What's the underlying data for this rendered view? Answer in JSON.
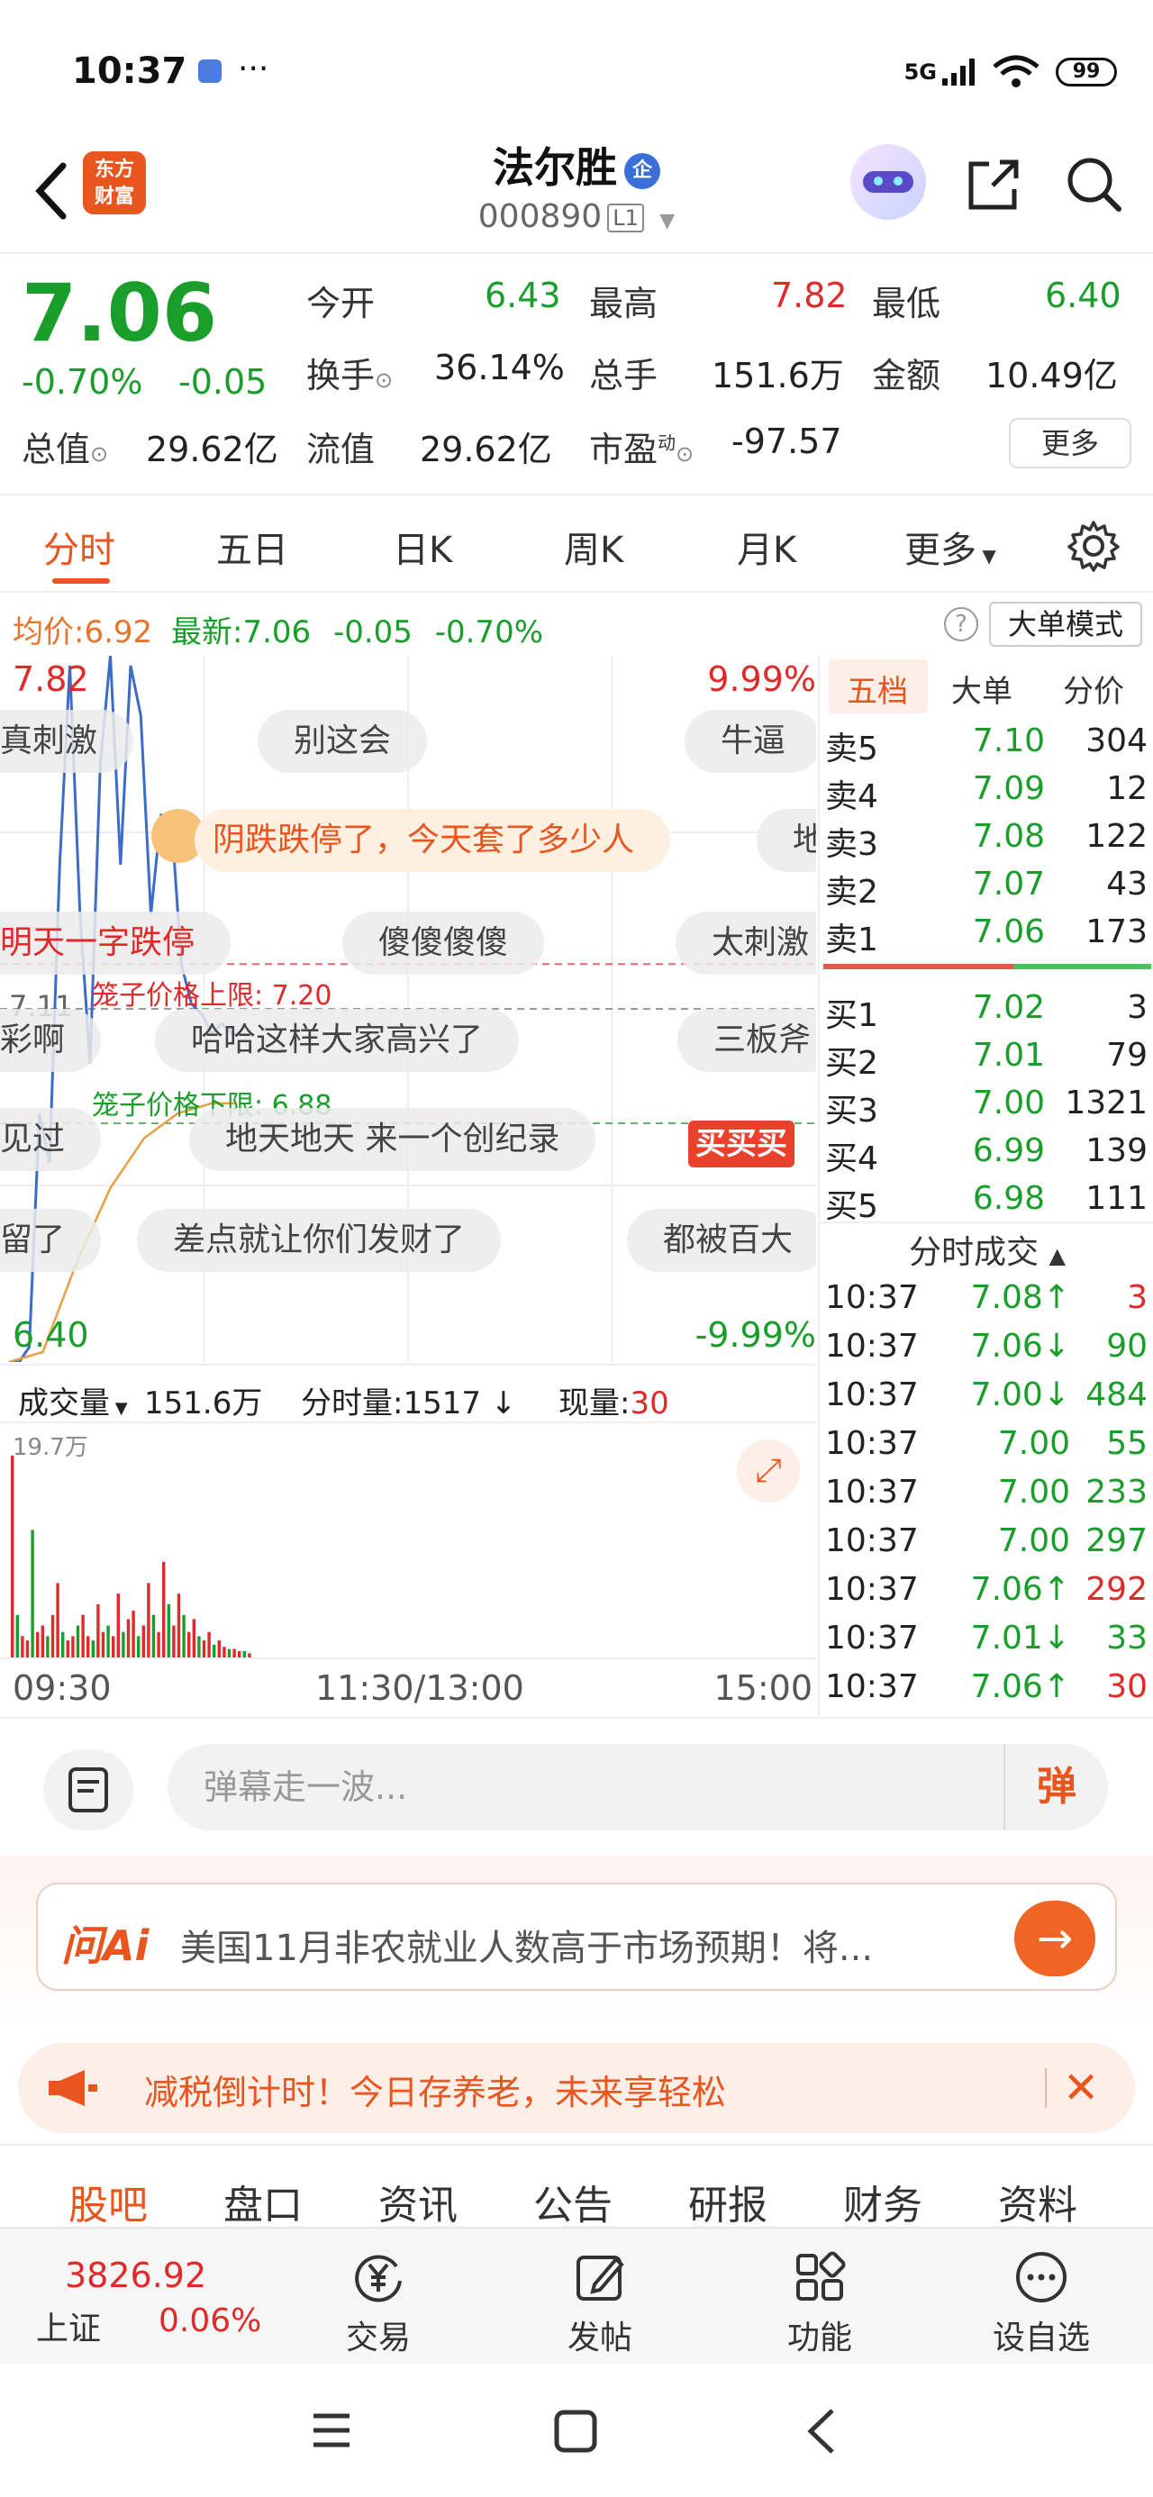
{
  "status": {
    "time": "10:37",
    "network": "5G",
    "battery": "99"
  },
  "header": {
    "logo_line1": "东方",
    "logo_line2": "财富",
    "stock_name": "法尔胜",
    "badge": "企",
    "stock_code": "000890",
    "level": "L1"
  },
  "quote": {
    "price": "7.06",
    "change_pct": "-0.70%",
    "change_abs": "-0.05",
    "open_label": "今开",
    "open": "6.43",
    "high_label": "最高",
    "high": "7.82",
    "low_label": "最低",
    "low": "6.40",
    "turnover_label": "换手",
    "turnover": "36.14%",
    "volume_label": "总手",
    "volume": "151.6万",
    "amount_label": "金额",
    "amount": "10.49亿",
    "mktcap_label": "总值",
    "mktcap": "29.62亿",
    "float_label": "流值",
    "float_cap": "29.62亿",
    "pe_label": "市盈",
    "pe_sup": "动",
    "pe": "-97.57",
    "more": "更多"
  },
  "tabs": [
    "分时",
    "五日",
    "日K",
    "周K",
    "月K",
    "更多"
  ],
  "avg_bar": {
    "avg_label": "均价:",
    "avg": "6.92",
    "last_label": "最新:",
    "last": "7.06",
    "chg": "-0.05",
    "pct": "-0.70%",
    "big_order": "大单模式"
  },
  "chart": {
    "high_price": "7.82",
    "high_pct": "9.99%",
    "low_price": "6.40",
    "low_pct": "-9.99%",
    "ref_price": "7.11",
    "cage_upper": "笼子价格上限: 7.20",
    "cage_lower": "笼子价格下限: 6.88",
    "danmu": [
      "真刺激",
      "别这会",
      "牛逼",
      "阴跌跌停了，今天套了多少人",
      "地",
      "明天一字跌停",
      "傻傻傻傻",
      "太刺激",
      "彩啊",
      "哈哈这样大家高兴了",
      "三板斧",
      "见过",
      "地天地天 来一个创纪录",
      "留了",
      "差点就让你们发财了",
      "都被百大"
    ],
    "buy_stamp": "买买买"
  },
  "chart_data": {
    "type": "line",
    "title": "",
    "x_ticks": [
      "09:30",
      "11:30/13:00",
      "15:00"
    ],
    "ylim": [
      6.4,
      7.82
    ],
    "series": [
      {
        "name": "最新",
        "x": [
          "09:30",
          "09:33",
          "09:36",
          "09:39",
          "09:42",
          "09:45",
          "09:48",
          "09:51",
          "09:54",
          "09:57",
          "10:00",
          "10:03",
          "10:06",
          "10:09",
          "10:12",
          "10:15",
          "10:18",
          "10:21",
          "10:24",
          "10:27",
          "10:30",
          "10:33",
          "10:36",
          "10:37"
        ],
        "values": [
          6.4,
          6.4,
          6.43,
          6.9,
          6.8,
          7.4,
          7.8,
          7.3,
          7.0,
          7.6,
          7.82,
          7.4,
          7.8,
          7.7,
          7.3,
          7.5,
          7.5,
          7.2,
          7.12,
          7.1,
          7.06,
          7.08,
          7.06,
          7.06
        ]
      },
      {
        "name": "均价",
        "x": [
          "09:30",
          "09:40",
          "09:50",
          "10:00",
          "10:10",
          "10:20",
          "10:30",
          "10:37"
        ],
        "values": [
          6.4,
          6.42,
          6.6,
          6.75,
          6.85,
          6.9,
          6.92,
          6.92
        ]
      }
    ]
  },
  "volume": {
    "label": "成交量",
    "total": "151.6万",
    "minute_label": "分时量:",
    "minute": "1517",
    "now_label": "现量:",
    "now": "30",
    "max": "19.7万",
    "x_start": "09:30",
    "x_mid": "11:30/13:00",
    "x_end": "15:00"
  },
  "orderbook": {
    "tabs": [
      "五档",
      "大单",
      "分价"
    ],
    "asks": [
      {
        "label": "卖5",
        "price": "7.10",
        "qty": "304"
      },
      {
        "label": "卖4",
        "price": "7.09",
        "qty": "12"
      },
      {
        "label": "卖3",
        "price": "7.08",
        "qty": "122"
      },
      {
        "label": "卖2",
        "price": "7.07",
        "qty": "43"
      },
      {
        "label": "卖1",
        "price": "7.06",
        "qty": "173"
      }
    ],
    "bids": [
      {
        "label": "买1",
        "price": "7.02",
        "qty": "3"
      },
      {
        "label": "买2",
        "price": "7.01",
        "qty": "79"
      },
      {
        "label": "买3",
        "price": "7.00",
        "qty": "1321"
      },
      {
        "label": "买4",
        "price": "6.99",
        "qty": "139"
      },
      {
        "label": "买5",
        "price": "6.98",
        "qty": "111"
      }
    ],
    "ticks_title": "分时成交",
    "ticks": [
      {
        "time": "10:37",
        "price": "7.08↑",
        "vol": "3"
      },
      {
        "time": "10:37",
        "price": "7.06↓",
        "vol": "90"
      },
      {
        "time": "10:37",
        "price": "7.00↓",
        "vol": "484"
      },
      {
        "time": "10:37",
        "price": "7.00",
        "vol": "55"
      },
      {
        "time": "10:37",
        "price": "7.00",
        "vol": "233"
      },
      {
        "time": "10:37",
        "price": "7.00",
        "vol": "297"
      },
      {
        "time": "10:37",
        "price": "7.06↑",
        "vol": "292"
      },
      {
        "time": "10:37",
        "price": "7.01↓",
        "vol": "33"
      },
      {
        "time": "10:37",
        "price": "7.06↑",
        "vol": "30"
      }
    ]
  },
  "comment": {
    "placeholder": "弹幕走一波...",
    "send": "弹"
  },
  "ai": {
    "logo": "问Ai",
    "text": "美国11月非农就业人数高于市场预期！将..."
  },
  "promo": {
    "text": "减税倒计时！今日存养老，未来享轻松"
  },
  "sub_tabs": [
    "股吧",
    "盘口",
    "资讯",
    "公告",
    "研报",
    "财务",
    "资料"
  ],
  "bottom_nav": {
    "index_value": "3826.92",
    "index_name": "上证",
    "index_pct": "0.06%",
    "items": [
      "交易",
      "发帖",
      "功能",
      "设自选"
    ]
  },
  "colors": {
    "up": "#e02a2a",
    "down": "#1a9e2b",
    "accent": "#e8551e",
    "price_line": "#3a6cc8",
    "avg_line": "#e8a040"
  }
}
